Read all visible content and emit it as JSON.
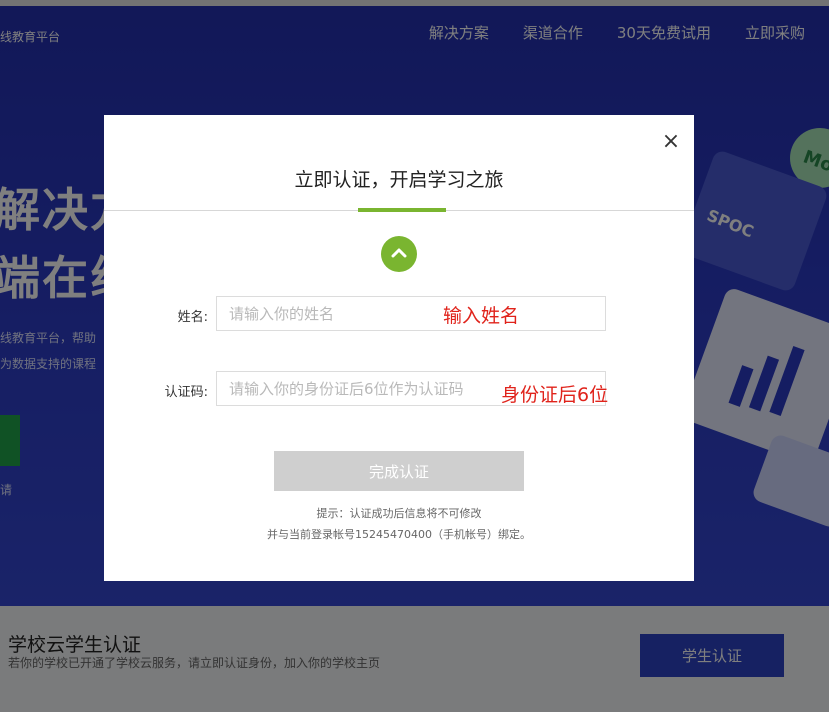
{
  "header": {
    "brand": "线教育平台",
    "nav": [
      "解决方案",
      "渠道合作",
      "30天免费试用",
      "立即采购"
    ]
  },
  "hero": {
    "line1": "解决方",
    "line2": "端在线",
    "desc1": "线教育平台，帮助",
    "desc2": "为数据支持的课程",
    "cta_text": "请",
    "illus_spoc": "SPOC",
    "illus_mooc": "Mo"
  },
  "footer": {
    "title": "学校云学生认证",
    "desc": "若你的学校已开通了学校云服务，请立即认证身份，加入你的学校主页",
    "button": "学生认证"
  },
  "modal": {
    "title": "立即认证，开启学习之旅",
    "close": "×",
    "name_label": "姓名:",
    "name_placeholder": "请输入你的姓名",
    "name_annotation": "输入姓名",
    "code_label": "认证码:",
    "code_placeholder": "请输入你的身份证后6位作为认证码",
    "code_annotation": "身份证后6位",
    "submit": "完成认证",
    "tip1": "提示：认证成功后信息将不可修改",
    "tip2": "并与当前登录帐号15245470400（手机帐号）绑定。"
  },
  "colors": {
    "accent_green": "#7ab530",
    "hero_blue": "#2b3ac4",
    "annotation_red": "#e0231b",
    "button_disabled": "#cfcfcf"
  },
  "icons": {
    "step": "chevron-up-icon",
    "close": "close-icon"
  }
}
